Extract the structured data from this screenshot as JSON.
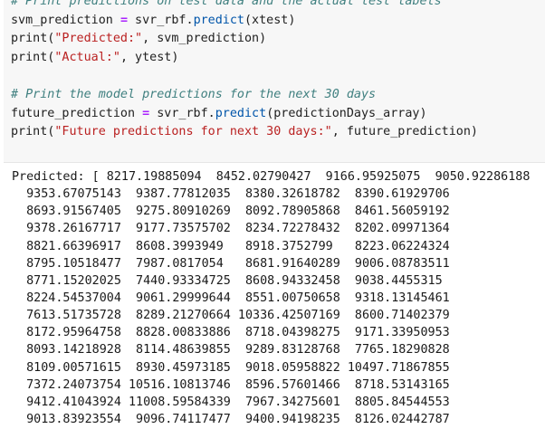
{
  "code_cell": {
    "lines": [
      [
        {
          "t": "# Print predictions on test data and the actual test labels",
          "c": "cm"
        }
      ],
      [
        {
          "t": "svm_prediction ",
          "c": ""
        },
        {
          "t": "=",
          "c": "op"
        },
        {
          "t": " svr_rbf.",
          "c": ""
        },
        {
          "t": "predict",
          "c": "fn"
        },
        {
          "t": "(xtest)",
          "c": ""
        }
      ],
      [
        {
          "t": "print(",
          "c": ""
        },
        {
          "t": "\"Predicted:\"",
          "c": "str"
        },
        {
          "t": ", svm_prediction)",
          "c": ""
        }
      ],
      [
        {
          "t": "print(",
          "c": ""
        },
        {
          "t": "\"Actual:\"",
          "c": "str"
        },
        {
          "t": ", ytest)",
          "c": ""
        }
      ],
      [],
      [
        {
          "t": "# Print the model predictions for the next 30 days",
          "c": "cm"
        }
      ],
      [
        {
          "t": "future_prediction ",
          "c": ""
        },
        {
          "t": "=",
          "c": "op"
        },
        {
          "t": " svr_rbf.",
          "c": ""
        },
        {
          "t": "predict",
          "c": "fn"
        },
        {
          "t": "(predictionDays_array)",
          "c": ""
        }
      ],
      [
        {
          "t": "print(",
          "c": ""
        },
        {
          "t": "\"Future predictions for next 30 days:\"",
          "c": "str"
        },
        {
          "t": ", future_prediction)",
          "c": ""
        }
      ]
    ]
  },
  "output": {
    "lines": [
      "Predicted: [ 8217.19885094  8452.02790427  9166.95925075  9050.92286188",
      "  9353.67075143  9387.77812035  8380.32618782  8390.61929706",
      "  8693.91567405  9275.80910269  8092.78905868  8461.56059192",
      "  9378.26167717  9177.73575702  8234.72278432  8202.09971364",
      "  8821.66396917  8608.3993949   8918.3752799   8223.06224324",
      "  8795.10518477  7987.0817054   8681.91640289  9006.08783511",
      "  8771.15202025  7440.93334725  8608.94332458  9038.4455315",
      "  8224.54537004  9061.29999644  8551.00750658  9318.13145461",
      "  7613.51735728  8289.21270664 10336.42507169  8600.71402379",
      "  8172.95964758  8828.00833886  8718.04398275  9171.33950953",
      "  8093.14218928  8114.48639855  9289.83128768  7765.18290828",
      "  8109.00571615  8930.45973185  9018.05958822 10497.71867855",
      "  7372.24073754 10516.10813746  8596.57601466  8718.53143165",
      "  9412.41043924 11008.59584339  7967.34275601  8805.84544553",
      "  9013.83923554  9096.74117477  9400.94198235  8126.02442787"
    ]
  }
}
